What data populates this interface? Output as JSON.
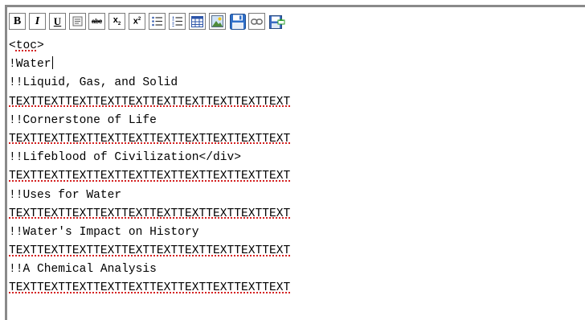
{
  "toolbar": {
    "buttons": [
      {
        "name": "bold-button",
        "icon": "bold-icon",
        "label": "B"
      },
      {
        "name": "italic-button",
        "icon": "italic-icon",
        "label": "I"
      },
      {
        "name": "underline-button",
        "icon": "underline-icon",
        "label": "U"
      },
      {
        "name": "paste-text-button",
        "icon": "paste-text-icon",
        "label": ""
      },
      {
        "name": "strikethrough-button",
        "icon": "strikethrough-icon",
        "label": "abc"
      },
      {
        "name": "subscript-button",
        "icon": "subscript-icon",
        "label": "x"
      },
      {
        "name": "superscript-button",
        "icon": "superscript-icon",
        "label": "x"
      },
      {
        "name": "bulleted-list-button",
        "icon": "bulleted-list-icon",
        "label": ""
      },
      {
        "name": "numbered-list-button",
        "icon": "numbered-list-icon",
        "label": ""
      },
      {
        "name": "table-button",
        "icon": "table-icon",
        "label": ""
      },
      {
        "name": "image-button",
        "icon": "image-icon",
        "label": ""
      },
      {
        "name": "save-button",
        "icon": "floppy-disk-icon",
        "label": ""
      },
      {
        "name": "link-button",
        "icon": "link-icon",
        "label": ""
      },
      {
        "name": "export-button",
        "icon": "export-icon",
        "label": ""
      }
    ]
  },
  "editor": {
    "lines": [
      {
        "text": "<toc>",
        "spell_word": "toc"
      },
      {
        "text": "!Water",
        "caret": true
      },
      {
        "text": "!!Liquid, Gas, and Solid"
      },
      {
        "text": "TEXTTEXTTEXTTEXTTEXTTEXTTEXTTEXTTEXTTEXT",
        "misspelled": true
      },
      {
        "text": "!!Cornerstone of Life"
      },
      {
        "text": "TEXTTEXTTEXTTEXTTEXTTEXTTEXTTEXTTEXTTEXT",
        "misspelled": true
      },
      {
        "text": "!!Lifeblood of Civilization</div>"
      },
      {
        "text": "TEXTTEXTTEXTTEXTTEXTTEXTTEXTTEXTTEXTTEXT",
        "misspelled": true
      },
      {
        "text": "!!Uses for Water"
      },
      {
        "text": "TEXTTEXTTEXTTEXTTEXTTEXTTEXTTEXTTEXTTEXT",
        "misspelled": true
      },
      {
        "text": "!!Water's Impact on History"
      },
      {
        "text": "TEXTTEXTTEXTTEXTTEXTTEXTTEXTTEXTTEXTTEXT",
        "misspelled": true
      },
      {
        "text": "!!A Chemical Analysis"
      },
      {
        "text": "TEXTTEXTTEXTTEXTTEXTTEXTTEXTTEXTTEXTTEXT",
        "misspelled": true
      }
    ]
  },
  "colors": {
    "frame_border": "#8a8a8a",
    "spellcheck_underline": "#d42020",
    "button_border": "#7a7a7a"
  }
}
